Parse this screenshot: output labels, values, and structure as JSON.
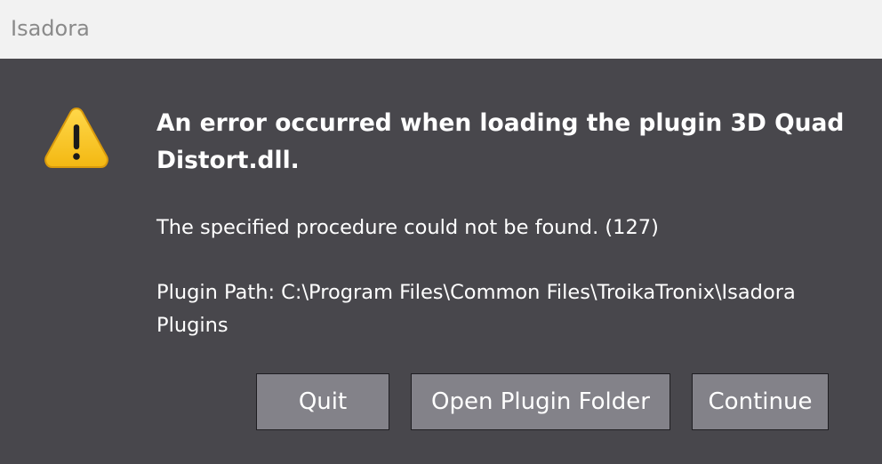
{
  "window": {
    "title": "Isadora"
  },
  "dialog": {
    "icon": "warning-icon",
    "heading": "An error occurred when loading the plugin 3D Quad Distort.dll.",
    "message": "The specified procedure could not be found. (127)",
    "plugin_path": "Plugin Path: C:\\Program Files\\Common Files\\TroikaTronix\\Isadora Plugins"
  },
  "buttons": {
    "quit": "Quit",
    "open_folder": "Open Plugin Folder",
    "continue": "Continue"
  },
  "colors": {
    "titlebar_bg": "#f2f2f2",
    "dialog_bg": "#48474c",
    "button_bg": "#838289",
    "warning_yellow": "#f7c51d"
  }
}
